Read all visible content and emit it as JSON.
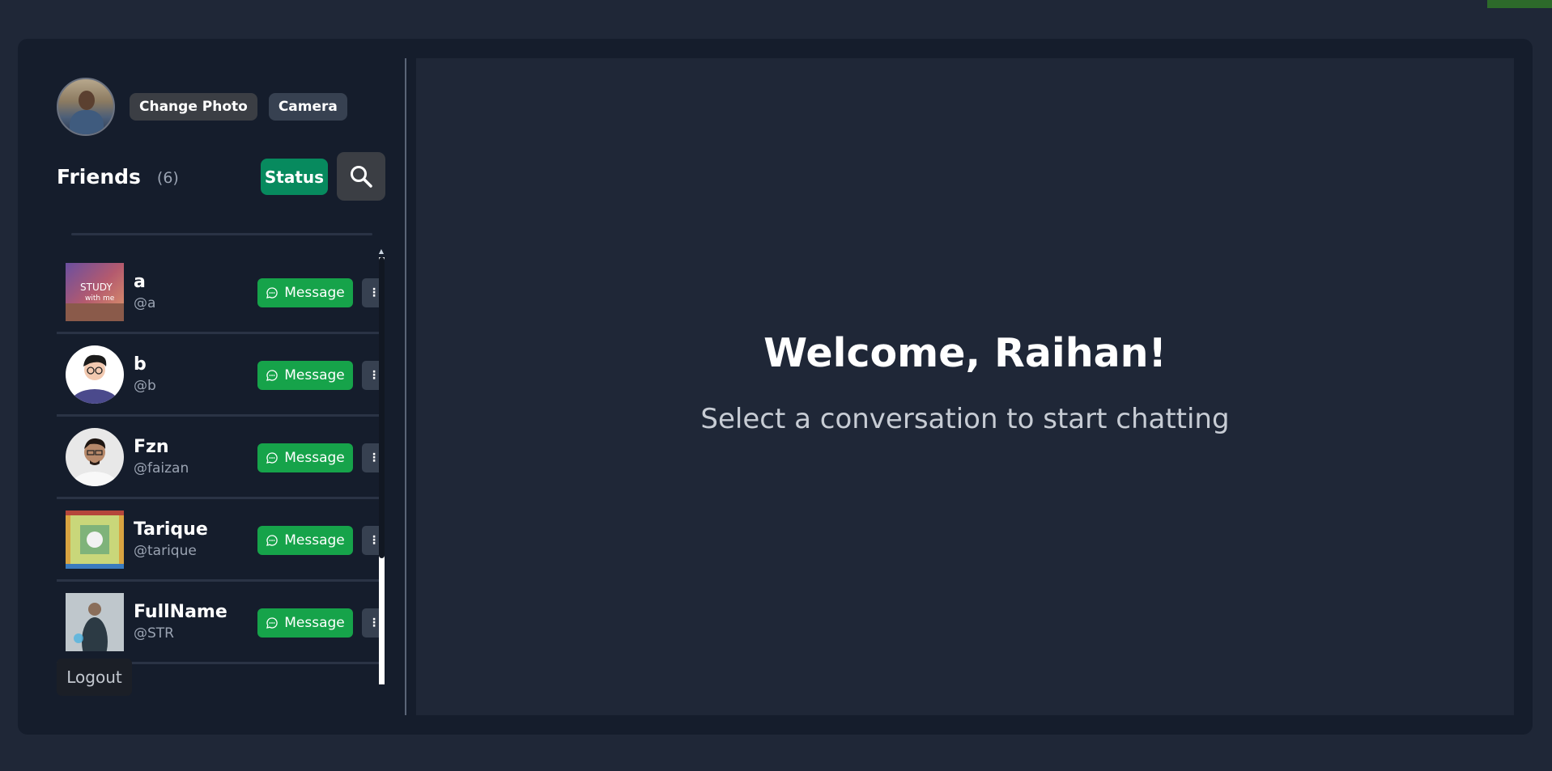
{
  "profile": {
    "change_photo_label": "Change Photo",
    "camera_label": "Camera"
  },
  "friends": {
    "title": "Friends",
    "count": "(6)",
    "status_label": "Status",
    "items": [
      {
        "name": "a",
        "handle": "@a",
        "message_label": "Message",
        "more_label": "⋮"
      },
      {
        "name": "b",
        "handle": "@b",
        "message_label": "Message",
        "more_label": "⋮"
      },
      {
        "name": "Fzn",
        "handle": "@faizan",
        "message_label": "Message",
        "more_label": "⋮"
      },
      {
        "name": "Tarique",
        "handle": "@tarique",
        "message_label": "Message",
        "more_label": "⋮"
      },
      {
        "name": "FullName",
        "handle": "@STR",
        "message_label": "Message",
        "more_label": "⋮"
      }
    ]
  },
  "logout_label": "Logout",
  "main": {
    "welcome": "Welcome, Raihan!",
    "subtitle": "Select a conversation to start chatting"
  },
  "colors": {
    "page_bg": "#1f2737",
    "panel_bg": "#151d2c",
    "status_green": "#078a5e",
    "message_green": "#16a34a"
  }
}
